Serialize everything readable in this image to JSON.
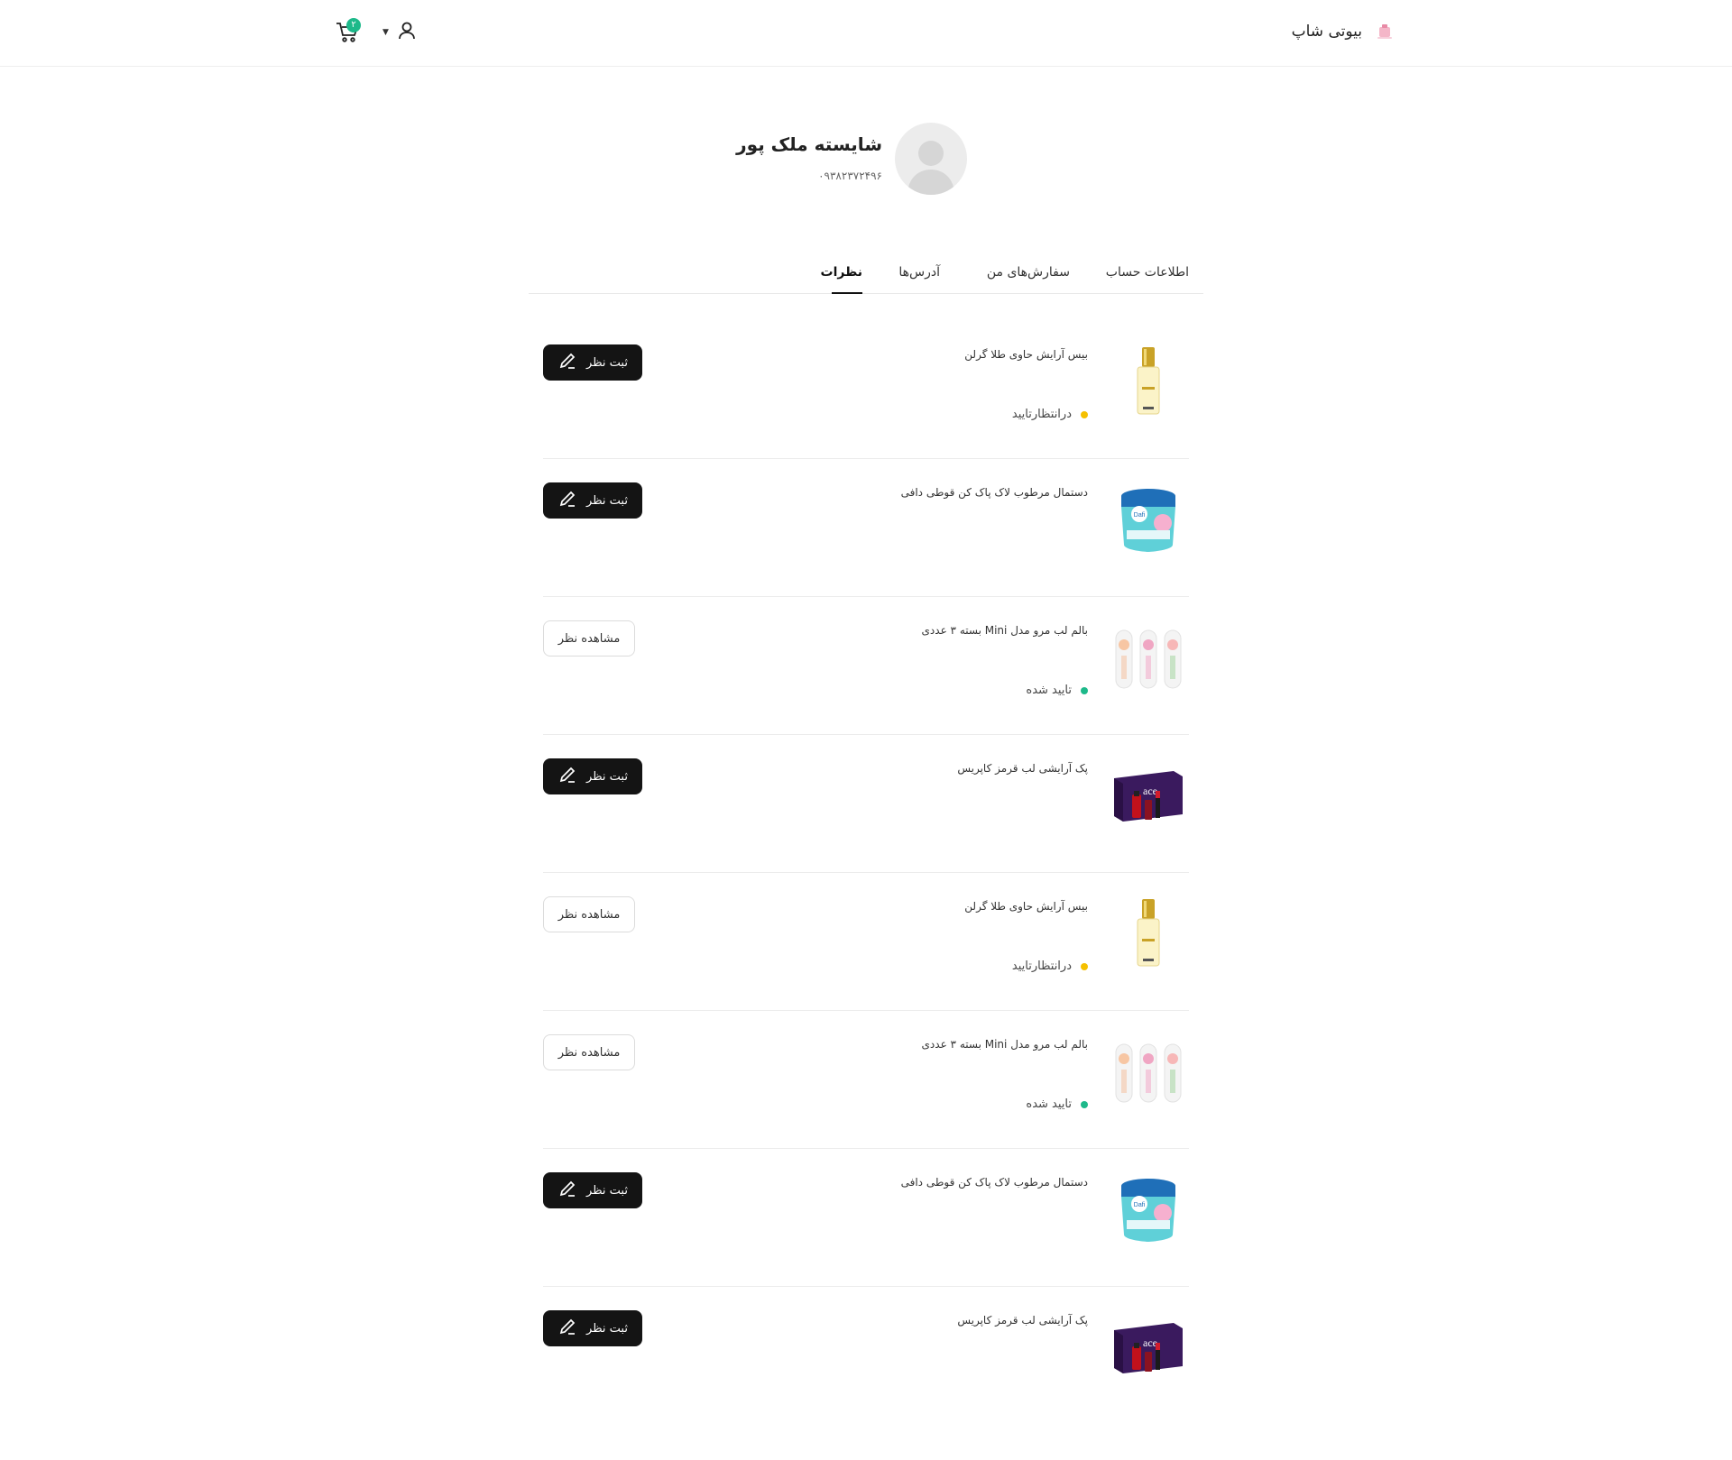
{
  "header": {
    "brand_name": "بیوتی شاپ",
    "cart_count": "۲",
    "accent_color": "#1db98a"
  },
  "profile": {
    "name": "شایسته ملک پور",
    "phone": "۰۹۳۸۲۳۷۲۴۹۶"
  },
  "tabs": [
    {
      "label": "اطلاعات حساب"
    },
    {
      "label": "سفارش‌های من"
    },
    {
      "label": "آدرس‌ها"
    },
    {
      "label": "نظرات"
    }
  ],
  "active_tab": "نظرات",
  "labels": {
    "submit": "ثبت نظر",
    "view": "مشاهده نظر"
  },
  "status_colors": {
    "pending": "#f5c000",
    "approved": "#1db98a"
  },
  "items": [
    {
      "name": "بیس آرایش حاوی طلا گرلن",
      "status": "درانتظارتایید",
      "status_type": "pending",
      "action": "submit",
      "product_icon": "gold-serum-bottle"
    },
    {
      "name": "دستمال مرطوب لاک پاک کن قوطی دافی",
      "status": "",
      "status_type": "",
      "action": "submit",
      "product_icon": "blue-wipes-jar"
    },
    {
      "name": "بالم لب مرو مدل Mini بسته ۳ عددی",
      "status": "تایید شده",
      "status_type": "approved",
      "action": "view",
      "product_icon": "lip-balm-trio"
    },
    {
      "name": "پک آرایشی لب قرمز کاپریس",
      "status": "",
      "status_type": "",
      "action": "submit",
      "product_icon": "purple-makeup-box"
    },
    {
      "name": "بیس آرایش حاوی طلا گرلن",
      "status": "درانتظارتایید",
      "status_type": "pending",
      "action": "view",
      "product_icon": "gold-serum-bottle"
    },
    {
      "name": "بالم لب مرو مدل Mini بسته ۳ عددی",
      "status": "تایید شده",
      "status_type": "approved",
      "action": "view",
      "product_icon": "lip-balm-trio"
    },
    {
      "name": "دستمال مرطوب لاک پاک کن قوطی دافی",
      "status": "",
      "status_type": "",
      "action": "submit",
      "product_icon": "blue-wipes-jar"
    },
    {
      "name": "پک آرایشی لب قرمز کاپریس",
      "status": "",
      "status_type": "",
      "action": "submit",
      "product_icon": "purple-makeup-box"
    }
  ]
}
